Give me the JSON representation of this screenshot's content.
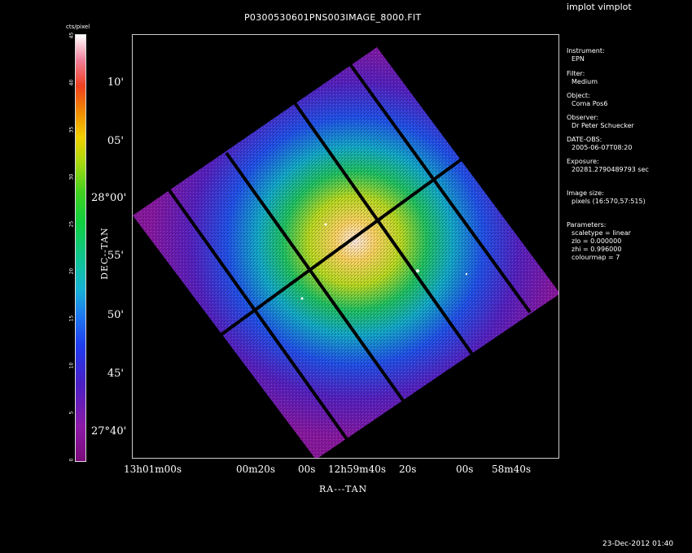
{
  "header": {
    "title": "P0300530601PNS003IMAGE_8000.FIT",
    "program": "implot vimplot"
  },
  "colorbar": {
    "label": "cts/pixel",
    "ticks": [
      "0",
      "5",
      "10",
      "15",
      "20",
      "25",
      "30",
      "35",
      "40",
      "45"
    ]
  },
  "axes": {
    "x_label": "RA---TAN",
    "y_label": "DEC--TAN",
    "x_ticks": [
      "13h01m00s",
      "00m20s",
      "00s",
      "12h59m40s",
      "20s",
      "00s",
      "58m40s"
    ],
    "y_ticks": [
      "10'",
      "05'",
      "28°00'",
      "55'",
      "50'",
      "45'",
      "27°40'"
    ]
  },
  "info": [
    {
      "label": "Instrument:",
      "value": "EPN"
    },
    {
      "label": "Filter:",
      "value": "Medium"
    },
    {
      "label": "Object:",
      "value": "Coma Pos6"
    },
    {
      "label": "Observer:",
      "value": "Dr Peter Schuecker"
    },
    {
      "label": "DATE-OBS:",
      "value": "2005-06-07T08:20"
    },
    {
      "label": "Exposure:",
      "value": "20281.2790489793 sec"
    },
    {
      "label": "Image size:",
      "value": "pixels (16:570,57:515)"
    },
    {
      "label": "Parameters:",
      "value": "scaletype = linear"
    },
    {
      "label": "",
      "value": "zlo = 0.000000"
    },
    {
      "label": "",
      "value": "zhi = 0.996000"
    },
    {
      "label": "",
      "value": "colourmap =   7"
    }
  ],
  "footer": {
    "date": "23-Dec-2012 01:40"
  }
}
